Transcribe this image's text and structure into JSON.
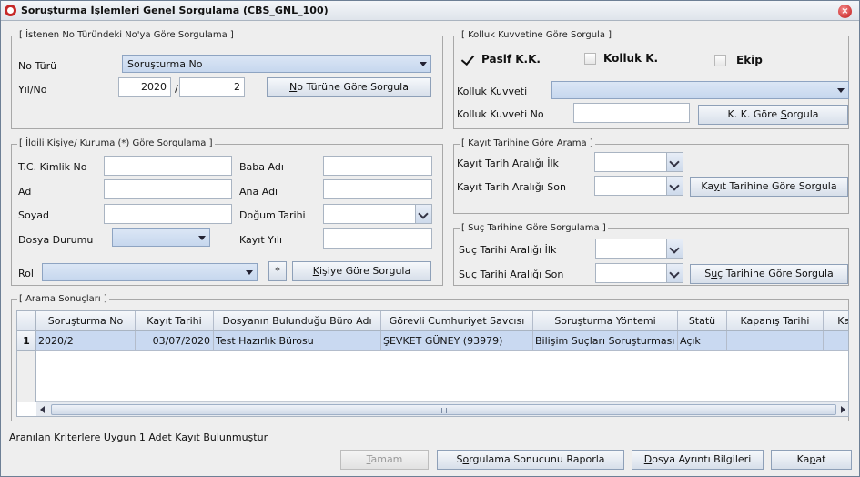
{
  "window": {
    "title": "Soruşturma İşlemleri Genel Sorgulama (CBS_GNL_100)"
  },
  "no_group": {
    "title": "[ İstenen No Türündeki No'ya Göre Sorgulama ]",
    "no_turu_label": "No Türü",
    "no_turu_value": "Soruşturma No",
    "yil_no_label": "Yıl/No",
    "year_value": "2020",
    "separator": "/",
    "no_value": "2",
    "button": "No Türüne Göre Sorgula",
    "button_mnemonic": "N",
    "button_rest": "o Türüne Göre Sorgula"
  },
  "kolluk_group": {
    "title": "[ Kolluk Kuvvetine Göre Sorgula ]",
    "pasif_label": "Pasif K.K.",
    "kolluk_label": "Kolluk K.",
    "ekip_label": "Ekip",
    "kuvvet_label": "Kolluk Kuvveti",
    "kuvvet_value": "",
    "kuvvet_no_label": "Kolluk Kuvveti No",
    "kuvvet_no_value": "",
    "button_pre": "K. K. Göre ",
    "button_mnemonic": "S",
    "button_rest": "orgula"
  },
  "kisi_group": {
    "title": "[ İlgili Kişiye/ Kuruma (*) Göre Sorgulama ]",
    "tc_label": "T.C. Kimlik No",
    "tc_value": "",
    "baba_label": "Baba Adı",
    "baba_value": "",
    "ad_label": "Ad",
    "ad_value": "",
    "ana_label": "Ana Adı",
    "ana_value": "",
    "soyad_label": "Soyad",
    "soyad_value": "",
    "dogum_label": "Doğum Tarihi",
    "dogum_value": "",
    "dosya_label": "Dosya Durumu",
    "dosya_value": "",
    "kayit_yili_label": "Kayıt Yılı",
    "kayit_yili_value": "",
    "rol_label": "Rol",
    "rol_value": "",
    "star_button": "*",
    "button_mnemonic": "K",
    "button_rest": "işiye Göre Sorgula"
  },
  "kayit_group": {
    "title": "[ Kayıt Tarihine Göre Arama ]",
    "ilk_label": "Kayıt Tarih Aralığı İlk",
    "ilk_value": "",
    "son_label": "Kayıt Tarih Aralığı Son",
    "son_value": "",
    "button_pre": "Ka",
    "button_mnemonic": "y",
    "button_rest": "ıt Tarihine Göre Sorgula"
  },
  "suc_group": {
    "title": "[ Suç Tarihine Göre Sorgulama ]",
    "ilk_label": "Suç Tarihi Aralığı İlk",
    "ilk_value": "",
    "son_label": "Suç Tarihi Aralığı Son",
    "son_value": "",
    "button_pre": "S",
    "button_mnemonic": "u",
    "button_rest": "ç Tarihine Göre Sorgula"
  },
  "results": {
    "title": "[ Arama Sonuçları ]",
    "columns": [
      "Soruşturma No",
      "Kayıt Tarihi",
      "Dosyanın Bulunduğu Büro Adı",
      "Görevli Cumhuriyet Savcısı",
      "Soruşturma Yöntemi",
      "Statü",
      "Kapanış Tarihi",
      "Ka"
    ],
    "rows": [
      {
        "num": "1",
        "cells": [
          "2020/2",
          "03/07/2020",
          "Test Hazırlık Bürosu",
          "ŞEVKET GÜNEY (93979)",
          "Bilişim Suçları Soruşturması",
          "Açık",
          "",
          ""
        ]
      }
    ]
  },
  "status_text": "Aranılan Kriterlere Uygun 1 Adet Kayıt Bulunmuştur",
  "footer": {
    "tamam_mnemonic": "T",
    "tamam_rest": "amam",
    "rapor_pre": "S",
    "rapor_mnemonic": "o",
    "rapor_rest": "rgulama Sonucunu Raporla",
    "dosya_mnemonic": "D",
    "dosya_rest": "osya Ayrıntı Bilgileri",
    "kapat_pre": "Ka",
    "kapat_mnemonic": "p",
    "kapat_rest": "at"
  },
  "colors": {
    "header_gradient_top": "#f5f7fa",
    "selected_row": "#c9d9f1",
    "combo": "#c6d7ee",
    "close": "#c01818"
  }
}
